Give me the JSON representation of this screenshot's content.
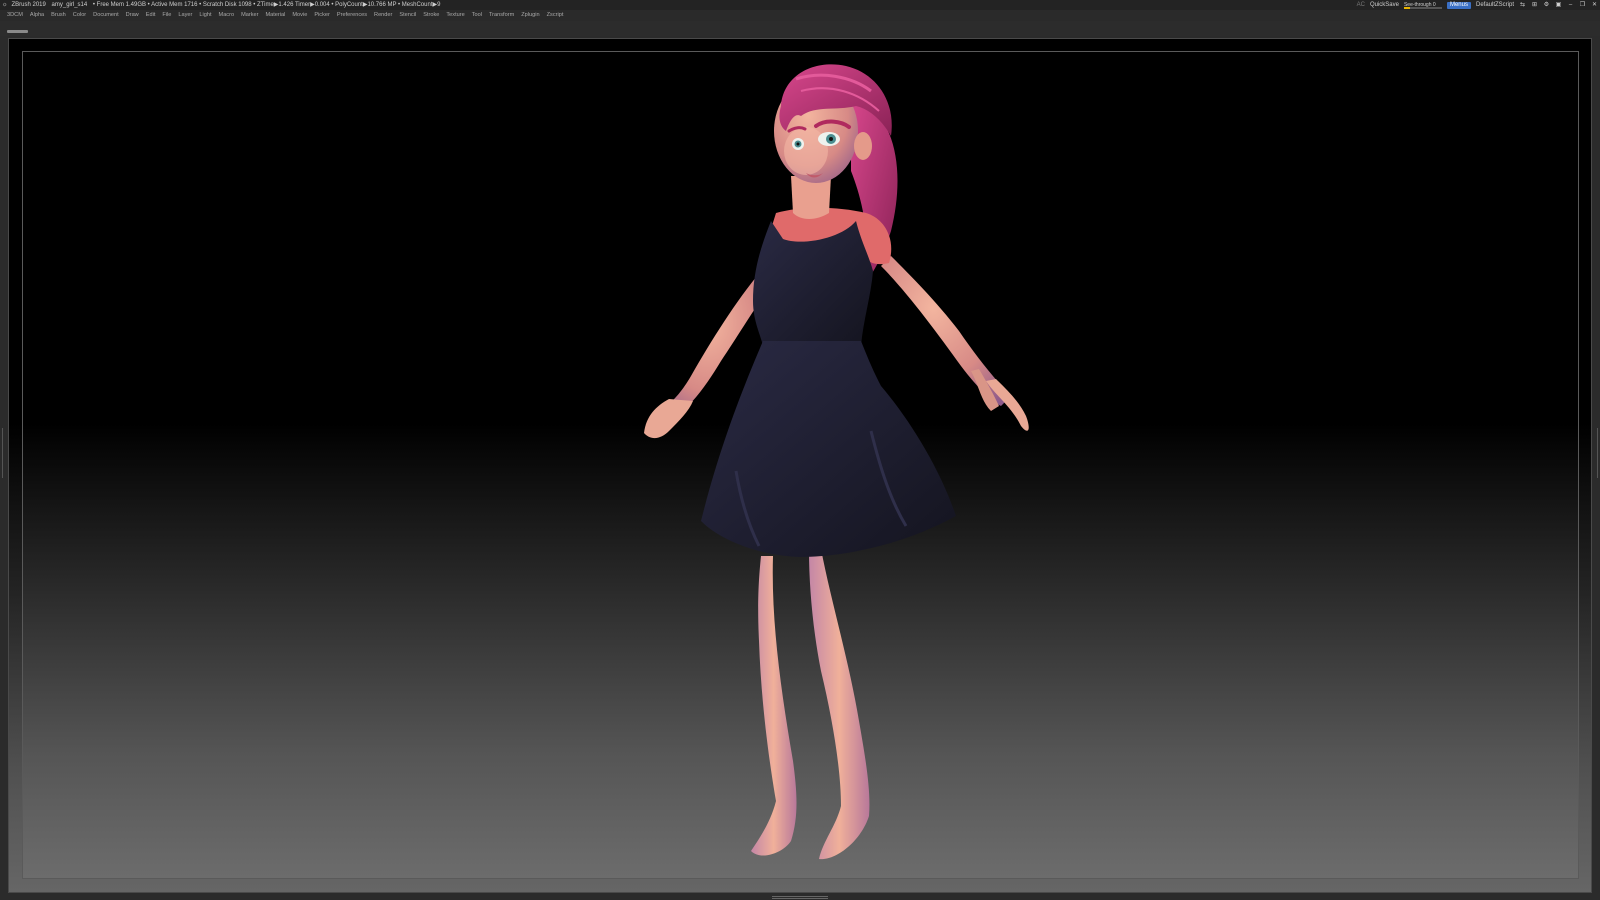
{
  "titlebar": {
    "app": "ZBrush 2019",
    "file": "amy_girl_s14",
    "stats": "• Free Mem 1.49GB • Active Mem 1716 • Scratch Disk 1098 •  ZTime▶1.426 Timer▶0.004 • PolyCount▶10.766 MP  • MeshCount▶9",
    "ac_label": "AC",
    "quicksave_label": "QuickSave",
    "seethrough_label": "See-through  0",
    "seethrough_value": 0,
    "menus_label": "Menus",
    "script_label": "DefaultZScript"
  },
  "menubar": {
    "items": [
      "3DCM",
      "Alpha",
      "Brush",
      "Color",
      "Document",
      "Draw",
      "Edit",
      "File",
      "Layer",
      "Light",
      "Macro",
      "Marker",
      "Material",
      "Movie",
      "Picker",
      "Preferences",
      "Render",
      "Stencil",
      "Stroke",
      "Texture",
      "Tool",
      "Transform",
      "Zplugin",
      "Zscript"
    ]
  },
  "colors": {
    "accent_blue": "#3a6fc4",
    "seethrough_fill": "#e8b400",
    "hair": "#b0306a",
    "skin": "#e9a08f",
    "dress": "#1f1f33",
    "shirt": "#e06a6a"
  },
  "icons": {
    "app_logo": "zbrush-logo-icon",
    "window_controls": [
      "layout-icon",
      "layout-icon",
      "settings-icon",
      "lock-icon",
      "minimize-icon",
      "restore-icon",
      "close-icon"
    ]
  }
}
